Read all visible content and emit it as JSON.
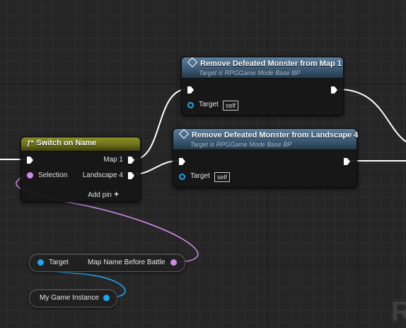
{
  "nodes": {
    "switch": {
      "title": "Switch on Name",
      "icon": "switch-icon",
      "header_color": "#6c7018",
      "outputs": [
        "Map 1",
        "Landscape 4"
      ],
      "input_label": "Selection",
      "add_pin_label": "Add pin",
      "add_pin_icon": "plus-icon"
    },
    "remove_map": {
      "title": "Remove Defeated Monster from Map 1",
      "subtitle": "Target is RPGGame Mode Base BP",
      "target_label": "Target",
      "target_value": "self",
      "header_color": "#3d5a75"
    },
    "remove_landscape": {
      "title": "Remove Defeated Monster from Landscape 4",
      "subtitle": "Target is RPGGame Mode Base BP",
      "target_label": "Target",
      "target_value": "self",
      "header_color": "#3d5a75"
    },
    "get_map_name": {
      "input_label": "Target",
      "output_label": "Map Name Before Battle"
    },
    "game_instance": {
      "output_label": "My Game Instance"
    }
  },
  "colors": {
    "exec_wire": "#ffffff",
    "name_wire": "#cd8ae8",
    "object_wire": "#1ea7ef"
  },
  "watermark": "R"
}
